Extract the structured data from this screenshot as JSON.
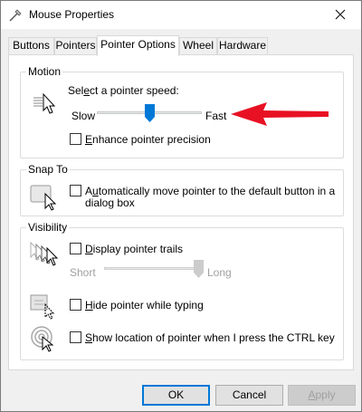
{
  "window": {
    "title": "Mouse Properties",
    "accent": "#0078d7",
    "arrow_color": "#e81123"
  },
  "tabs": [
    {
      "label": "Buttons",
      "active": false
    },
    {
      "label": "Pointers",
      "active": false
    },
    {
      "label": "Pointer Options",
      "active": true
    },
    {
      "label": "Wheel",
      "active": false
    },
    {
      "label": "Hardware",
      "active": false
    }
  ],
  "motion": {
    "group_title": "Motion",
    "speed_prefix": "Sel",
    "speed_mnemonic": "e",
    "speed_suffix": "ct a pointer speed:",
    "slow_label": "Slow",
    "fast_label": "Fast",
    "speed_value": 0.5,
    "enhance_mnemonic": "E",
    "enhance_rest": "nhance pointer precision",
    "enhance_checked": false
  },
  "snap_to": {
    "group_title": "Snap To",
    "line1_prefix": "A",
    "line1_mnemonic": "u",
    "line1_rest": "tomatically move pointer to the default button in a",
    "line2": "dialog box",
    "checked": false
  },
  "visibility": {
    "group_title": "Visibility",
    "trails_mnemonic": "D",
    "trails_rest": "isplay pointer trails",
    "trails_checked": false,
    "short_label": "Short",
    "long_label": "Long",
    "trail_value": 1.0,
    "hide_mnemonic": "H",
    "hide_rest": "ide pointer while typing",
    "hide_checked": false,
    "show_mnemonic": "S",
    "show_rest": "how location of pointer when I press the CTRL key",
    "show_checked": false
  },
  "dialog_buttons": {
    "ok": "OK",
    "cancel": "Cancel",
    "apply_mnemonic": "A",
    "apply_rest": "pply"
  }
}
